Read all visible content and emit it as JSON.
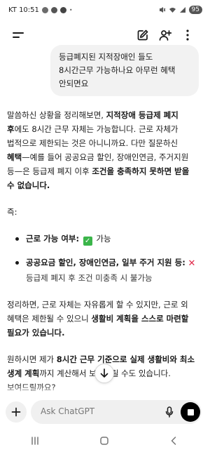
{
  "status_bar": {
    "carrier_time": "KT 10:51",
    "battery": "95"
  },
  "composer": {
    "placeholder": "Ask ChatGPT"
  },
  "user_message": {
    "lines": [
      "등급폐지된 지적장애인 들도",
      "8시간근무 가능하나요 아무런 혜택",
      "안되면요"
    ]
  },
  "assistant": {
    "p1": {
      "l1a": "말씀하신 상황을 정리해보면, ",
      "l1b": "지적장애 등급제 폐지",
      "l2a": "후",
      "l2b": "에도 8시간 근무 자체는 가능합니다. 근로 자체가",
      "l3": "법적으로 제한되는 것은 아니니까요. 다만 질문하신",
      "l4a": "혜택",
      "l4b": "—예를 들어 공공요금 할인, 장애인연금, 주거지원",
      "l5a": "등—은 등급제 폐지 이후 ",
      "l5b": "조건을 충족하지 못하면 받을",
      "l6": "수 없습니다."
    },
    "jeuk": "즉:",
    "bullet1": {
      "label": "근로 가능 여부:",
      "value": "가능"
    },
    "bullet2": {
      "label1": "공공요금 할인, 장애인연금, 일부 주거 지원 등:",
      "sub": "등급제 폐지 후 조건 미충족 시 불가능"
    },
    "p2": {
      "l1": "정리하면, 근로 자체는 자유롭게 할 수 있지만, 근로 외",
      "l2a": "혜택은 제한될 수 있으니 ",
      "l2b": "생활비 계획을 스스로 마련할",
      "l3": "필요가 있습니다."
    },
    "p3": {
      "l1a": "원하시면 제가 ",
      "l1b": "8시간 근무 기준으로 실제 생활비와 최소",
      "l2a": "생계 계획",
      "l2b": "까지 계산해서 보여드릴 수도 있습니다.",
      "l3": "보여드릴까요?"
    }
  },
  "colors": {
    "check": "#3bb54a",
    "cross": "#e0294a",
    "bubble": "#f2f2f2"
  },
  "icons": [
    "menu-icon",
    "edit-icon",
    "add-user-icon",
    "more-icon",
    "arrow-down-icon",
    "plus-icon",
    "mic-icon",
    "stop-icon",
    "check-icon",
    "cross-icon"
  ]
}
